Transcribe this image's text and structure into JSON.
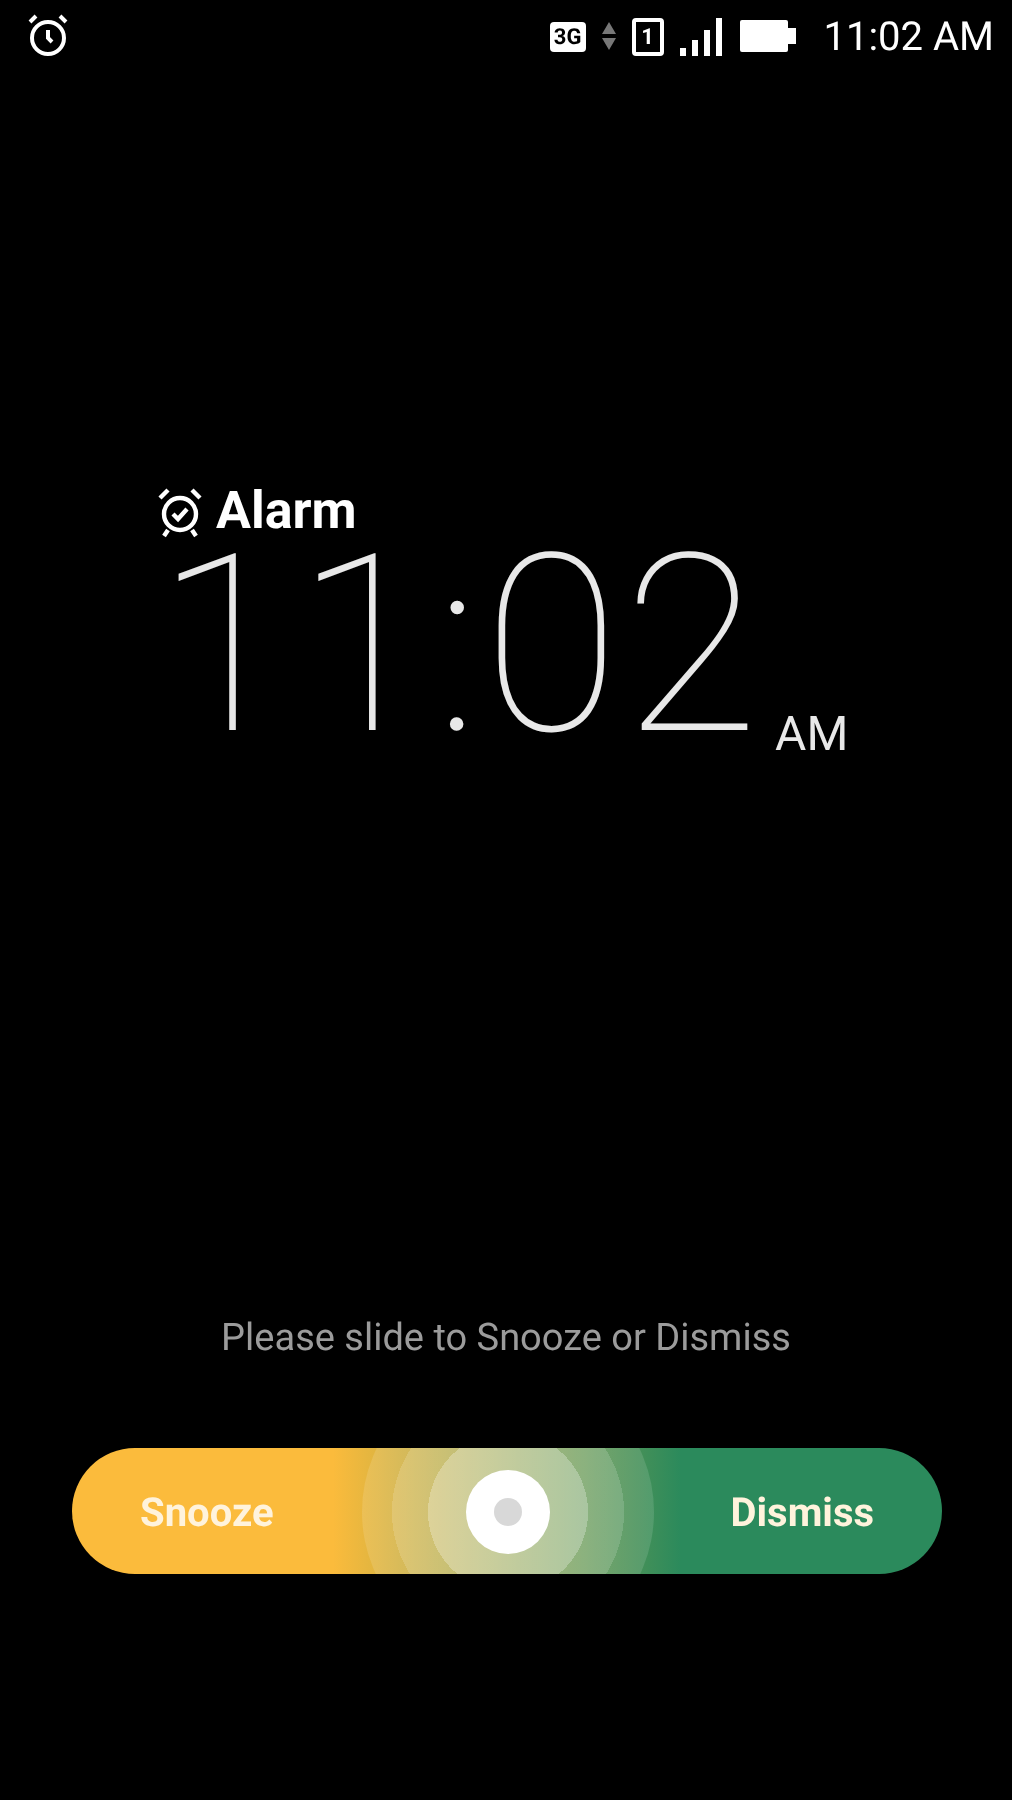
{
  "status_bar": {
    "network": "3G",
    "sim": "1",
    "time": "11:02 AM"
  },
  "alarm": {
    "label": "Alarm",
    "time": "11:02",
    "meridiem": "AM"
  },
  "hint": "Please slide to Snooze or Dismiss",
  "slider": {
    "left_label": "Snooze",
    "right_label": "Dismiss",
    "level": 0.5
  }
}
